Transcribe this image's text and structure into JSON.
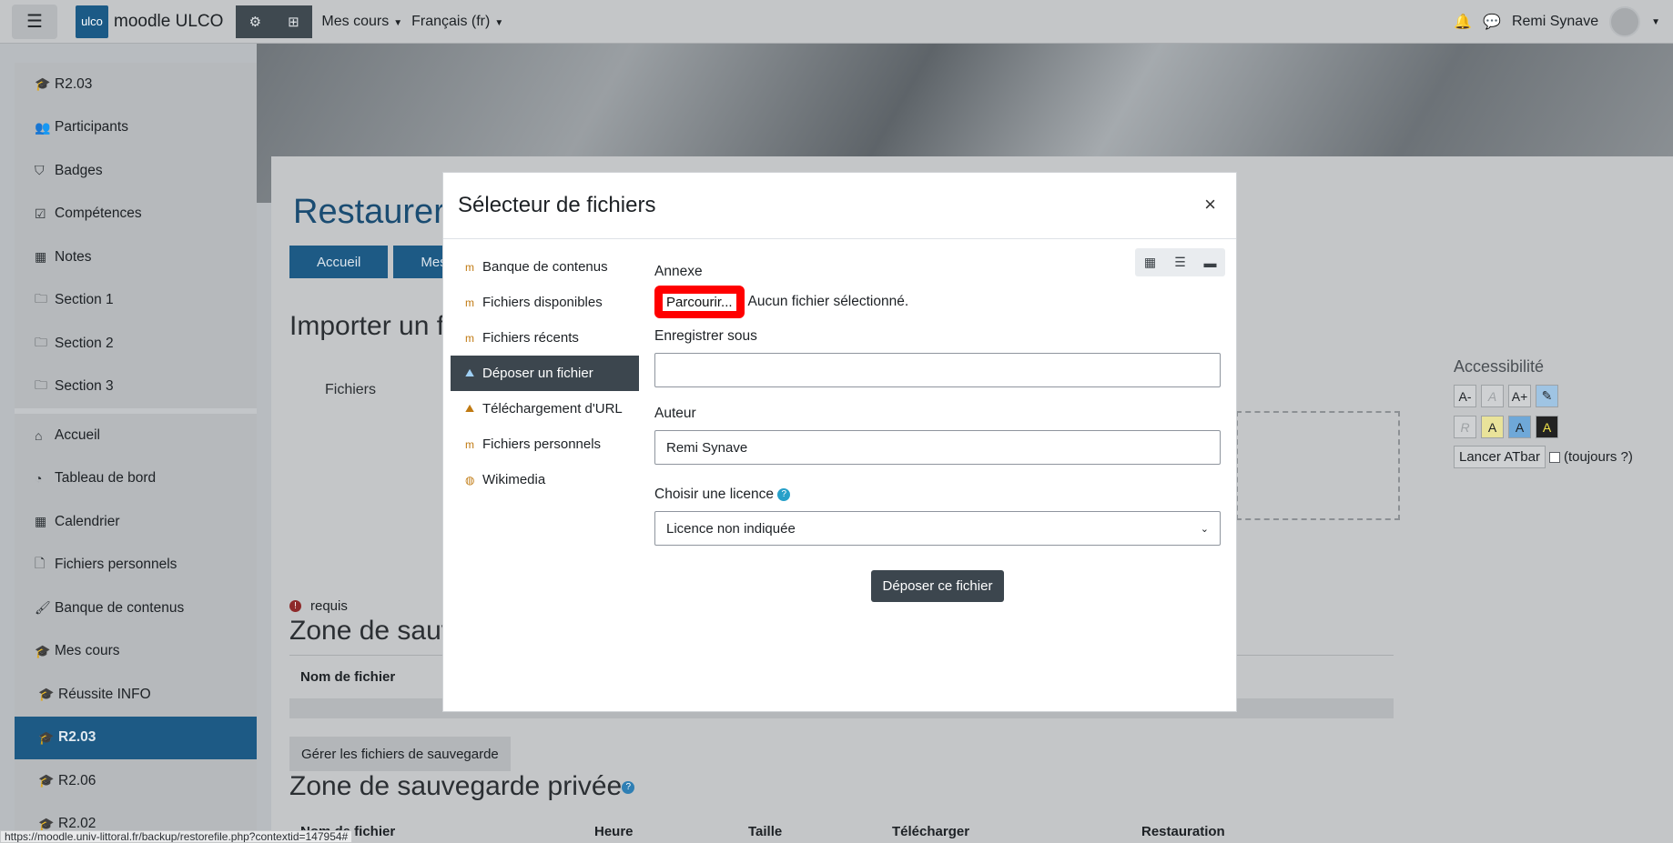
{
  "navbar": {
    "brand_logo": "ulco",
    "brand_name": "moodle ULCO",
    "menu_courses": "Mes cours",
    "menu_language": "Français (fr)",
    "user_name": "Remi Synave"
  },
  "sidebar": {
    "items": [
      {
        "label": "R2.03",
        "icon": "graduation-cap-icon"
      },
      {
        "label": "Participants",
        "icon": "users-icon"
      },
      {
        "label": "Badges",
        "icon": "shield-icon"
      },
      {
        "label": "Compétences",
        "icon": "check-square-icon"
      },
      {
        "label": "Notes",
        "icon": "table-icon"
      },
      {
        "label": "Section 1",
        "icon": "folder-icon"
      },
      {
        "label": "Section 2",
        "icon": "folder-icon"
      },
      {
        "label": "Section 3",
        "icon": "folder-icon"
      }
    ],
    "items2": [
      {
        "label": "Accueil",
        "icon": "home-icon"
      },
      {
        "label": "Tableau de bord",
        "icon": "dashboard-icon"
      },
      {
        "label": "Calendrier",
        "icon": "calendar-icon"
      },
      {
        "label": "Fichiers personnels",
        "icon": "file-icon"
      },
      {
        "label": "Banque de contenus",
        "icon": "paintbrush-icon"
      },
      {
        "label": "Mes cours",
        "icon": "graduation-cap-icon"
      },
      {
        "label": "Réussite INFO",
        "icon": "graduation-cap-icon"
      },
      {
        "label": "R2.03",
        "icon": "graduation-cap-icon"
      },
      {
        "label": "R2.06",
        "icon": "graduation-cap-icon"
      },
      {
        "label": "R2.02",
        "icon": "graduation-cap-icon"
      }
    ]
  },
  "page": {
    "title": "Restaurer",
    "crumb_home": "Accueil",
    "crumb_courses": "Mes co",
    "import_heading": "Importer un f",
    "files_label": "Fichiers",
    "required": "requis",
    "zone_heading": "Zone de sauv",
    "col_filename": "Nom de fichier",
    "manage_button": "Gérer les fichiers de sauvegarde",
    "private_zone_heading": "Zone de sauvegarde privée",
    "cols": {
      "filename": "Nom de fichier",
      "time": "Heure",
      "size": "Taille",
      "download": "Télécharger",
      "restore": "Restauration"
    }
  },
  "accessibility": {
    "title": "Accessibilité",
    "row1": [
      "A-",
      "A",
      "A+",
      ""
    ],
    "row2": [
      "R",
      "A",
      "A",
      "A"
    ],
    "launch": "Lancer ATbar",
    "always": "(toujours ?)"
  },
  "modal": {
    "title": "Sélecteur de fichiers",
    "close": "×",
    "repos": [
      {
        "label": "Banque de contenus"
      },
      {
        "label": "Fichiers disponibles"
      },
      {
        "label": "Fichiers récents"
      },
      {
        "label": "Déposer un fichier"
      },
      {
        "label": "Téléchargement d'URL"
      },
      {
        "label": "Fichiers personnels"
      },
      {
        "label": "Wikimedia"
      }
    ],
    "attachment_label": "Annexe",
    "browse_button": "Parcourir...",
    "no_file": "Aucun fichier sélectionné.",
    "save_as_label": "Enregistrer sous",
    "save_as_value": "",
    "author_label": "Auteur",
    "author_value": "Remi Synave",
    "license_label": "Choisir une licence",
    "license_value": "Licence non indiquée",
    "submit_button": "Déposer ce fichier"
  },
  "status_url": "https://moodle.univ-littoral.fr/backup/restorefile.php?contextid=147954#"
}
